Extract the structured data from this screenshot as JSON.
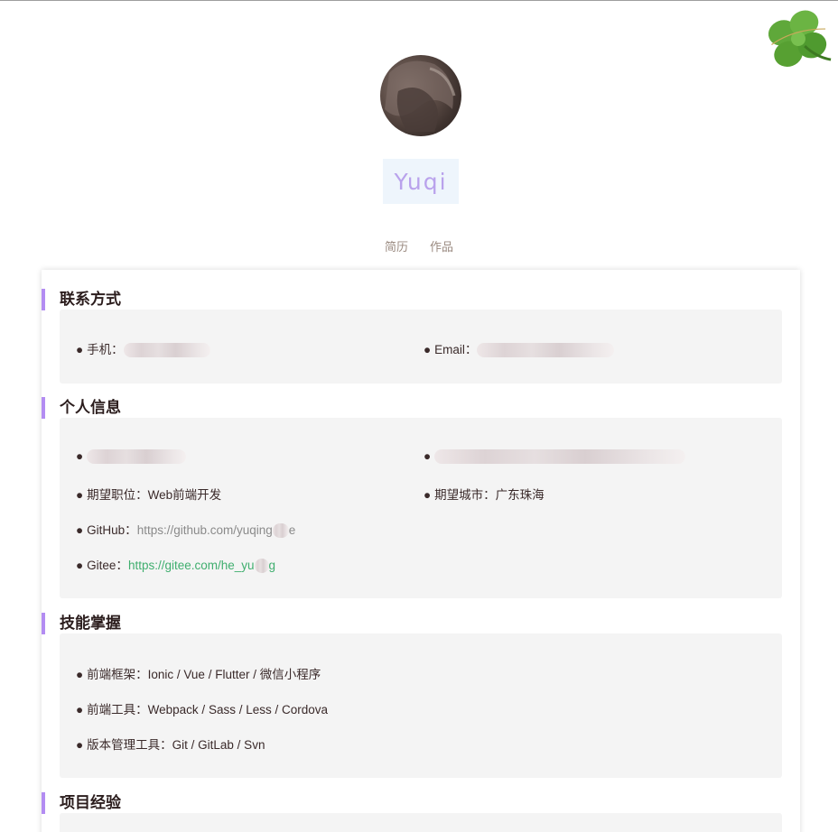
{
  "profile": {
    "name": "Yuqi"
  },
  "nav": {
    "resume": "简历",
    "works": "作品"
  },
  "sections": {
    "contact": {
      "title": "联系方式",
      "phone_label": "手机：",
      "email_label": "Email："
    },
    "personal": {
      "title": "个人信息",
      "position_label": "期望职位：",
      "position_value": "Web前端开发",
      "city_label": "期望城市：",
      "city_value": "广东珠海",
      "github_label": "GitHub：",
      "github_value": "https://github.com/yuqing",
      "github_tail": "e",
      "gitee_label": "Gitee：",
      "gitee_value": "https://gitee.com/he_yu",
      "gitee_tail": "g"
    },
    "skills": {
      "title": "技能掌握",
      "frameworks": "前端框架：Ionic / Vue / Flutter / 微信小程序",
      "tools": "前端工具：Webpack / Sass / Less / Cordova",
      "vcs": "版本管理工具：Git / GitLab / Svn"
    },
    "projects": {
      "title": "项目经验"
    }
  },
  "bullet": "●",
  "colors": {
    "accent": "#b38cf2",
    "name": "#b9a2ec",
    "link_green": "#3fae6e"
  },
  "icons": {
    "clover": "four-leaf-clover-icon"
  }
}
